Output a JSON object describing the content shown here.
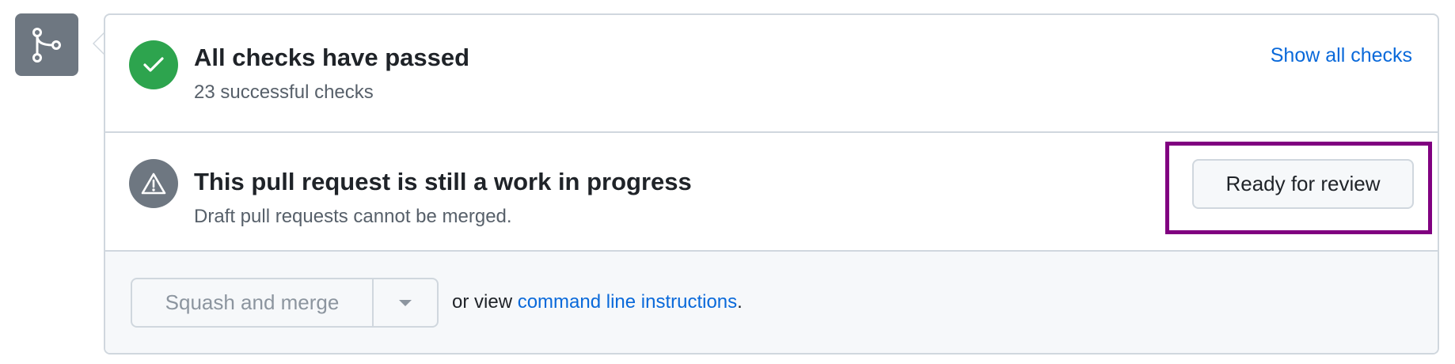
{
  "checks": {
    "title": "All checks have passed",
    "subtitle": "23 successful checks",
    "show_all_label": "Show all checks"
  },
  "draft": {
    "title": "This pull request is still a work in progress",
    "subtitle": "Draft pull requests cannot be merged.",
    "ready_button_label": "Ready for review"
  },
  "merge": {
    "button_label": "Squash and merge",
    "or_view_text": "or view ",
    "command_line_link": "command line instructions",
    "period": "."
  },
  "icons": {
    "merge_tile": "git-merge-icon",
    "success": "check-icon",
    "alert": "alert-icon",
    "dropdown": "triangle-down-icon"
  },
  "colors": {
    "success": "#2da44e",
    "neutral": "#6e7781",
    "link": "#0969da",
    "highlight": "#800080"
  }
}
